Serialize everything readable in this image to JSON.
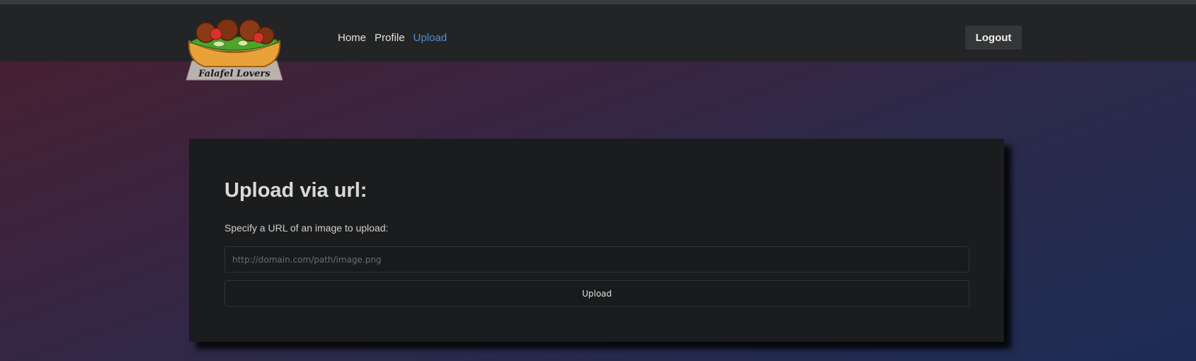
{
  "nav": {
    "logo_text": "Falafel Lovers",
    "links": [
      {
        "label": "Home",
        "active": false
      },
      {
        "label": "Profile",
        "active": false
      },
      {
        "label": "Upload",
        "active": true
      }
    ],
    "logout_label": "Logout"
  },
  "upload": {
    "title": "Upload via url:",
    "description": "Specify a URL of an image to upload:",
    "url_input": {
      "value": "",
      "placeholder": "http://domain.com/path/image.png"
    },
    "button_label": "Upload"
  },
  "colors": {
    "navbar_bg": "#232425",
    "active_link": "#4f8fd4",
    "card_bg": "#1b1c1d"
  }
}
